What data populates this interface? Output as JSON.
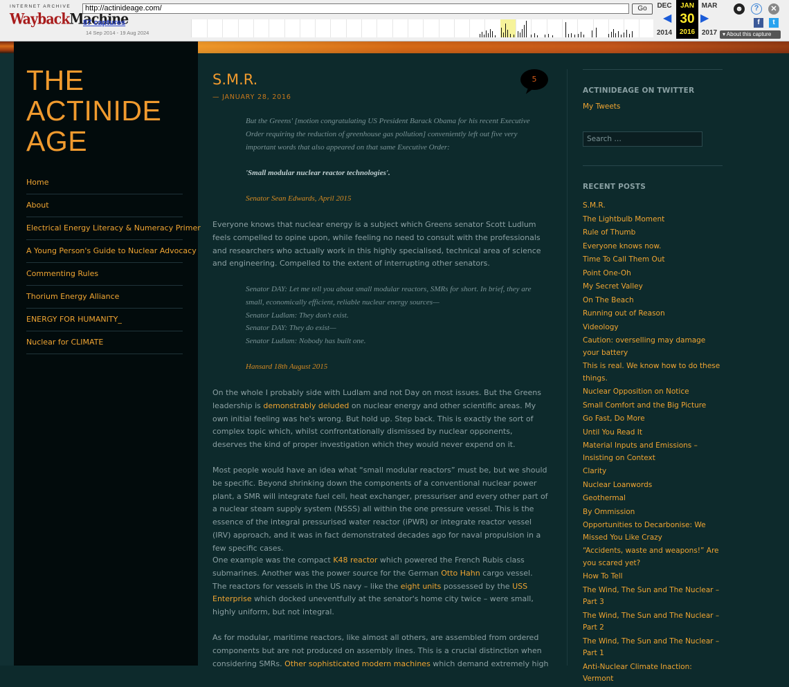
{
  "wayback": {
    "logo_top": "INTERNET ARCHIVE",
    "logo_way": "Wayback",
    "logo_machine": "Machine",
    "url": "http://actinideage.com/",
    "go_label": "Go",
    "captures": "87 captures",
    "range": "14 Sep 2014 - 19 Aug 2024",
    "prev_month": "DEC",
    "prev_year": "2014",
    "cur_month": "JAN",
    "cur_day": "30",
    "cur_year": "2016",
    "next_month": "MAR",
    "next_year": "2017",
    "about": "About this capture",
    "icons": [
      "user-icon",
      "help-icon",
      "close-icon",
      "facebook-icon",
      "twitter-icon"
    ]
  },
  "site": {
    "title_line1": "THE",
    "title_line2": "ACTINIDE",
    "title_line3": "AGE",
    "nav": [
      "Home",
      "About",
      "Electrical Energy Literacy & Numeracy Primer",
      "A Young Person's Guide to Nuclear Advocacy",
      "Commenting Rules",
      "Thorium Energy Alliance",
      "ENERGY FOR HUMANITY_",
      "Nuclear for CLIMATE"
    ]
  },
  "post": {
    "title": "S.M.R.",
    "date": "— JANUARY 28, 2016",
    "comments": "5",
    "quote1": "But the Greens' [motion congratulating US President Barack Obama for his recent Executive Order requiring the reduction of greenhouse gas pollution] conveniently left out five very important words that also appeared on that same Executive Order:",
    "quote1_bold": "'Small modular nuclear reactor technologies'.",
    "cite1": "Senator Sean Edwards, April 2015",
    "para1": "Everyone knows that nuclear energy is a subject which Greens senator Scott Ludlum feels compelled to opine upon, while feeling no need to consult with the professionals and researchers who actually work in this highly specialised, technical area of science and engineering. Compelled to the extent of interrupting other senators.",
    "quote2_l1": "Senator DAY: Let me tell you about small modular reactors, SMRs for short. In brief, they are small, economically efficient, reliable nuclear energy sources—",
    "quote2_l2": "Senator Ludlam: They don't exist.",
    "quote2_l3": "Senator DAY: They do exist—",
    "quote2_l4": "Senator Ludlam: Nobody has built one.",
    "cite2": "Hansard 18th August 2015",
    "para2_a": "On the whole I probably side with Ludlam and not Day on most issues. But the Greens leadership is ",
    "para2_link": "demonstrably deluded",
    "para2_b": " on nuclear energy and other scientific areas. My own initial feeling was he's wrong. But hold up. Step back. This is exactly the sort of complex topic which, whilst confrontationally dismissed by nuclear opponents, deserves the kind of proper investigation which they would never expend on it.",
    "para3": "Most people would have an idea what “small modular reactors” must be, but we should be specific. Beyond shrinking down the components of a conventional nuclear power plant, a SMR will integrate fuel cell, heat exchanger, pressuriser and every other part of a nuclear steam supply system (NSSS) all within the one pressure vessel. This is the essence of the integral pressurised water reactor (iPWR) or integrate reactor vessel (IRV) approach, and it was in fact demonstrated decades ago for naval propulsion in a few specific cases.",
    "para4_a": "One example was the compact ",
    "para4_link1": "K48 reactor",
    "para4_b": " which powered the French Rubis class submarines. Another was the power source for the German ",
    "para4_link2": "Otto Hahn",
    "para4_c": " cargo vessel. The reactors for vessels in the US navy – like the ",
    "para4_link3": "eight units",
    "para4_d": " possessed by the ",
    "para4_link4": "USS Enterprise",
    "para4_e": " which docked uneventfully at the senator's home city twice – were small, highly uniform, but not integral.",
    "para5_a": "As for modular, maritime reactors, like almost all others, are assembled from ordered components but are not produced on assembly lines. This is a crucial distinction when considering SMRs. ",
    "para5_link": "Other sophisticated modern machines",
    "para5_b": " which demand extremely high"
  },
  "sidebar": {
    "twitter_heading": "ACTINIDEAGE ON TWITTER",
    "my_tweets": "My Tweets",
    "search_placeholder": "Search …",
    "recent_heading": "RECENT POSTS",
    "recent": [
      "S.M.R.",
      "The Lightbulb Moment",
      "Rule of Thumb",
      "Everyone knows now.",
      "Time To Call Them Out",
      "Point One-Oh",
      "My Secret Valley",
      "On The Beach",
      "Running out of Reason",
      "Videology",
      "Caution: overselling may damage your battery",
      "This is real. We know how to do these things.",
      "Nuclear Opposition on Notice",
      "Small Comfort and the Big Picture",
      "Go Fast, Do More",
      "Until You Read It",
      "Material Inputs and Emissions – Insisting on Context",
      "Clarity",
      "Nuclear Loanwords",
      "Geothermal",
      "By Ommission",
      "Opportunities to Decarbonise: We Missed You Like Crazy",
      "“Accidents, waste and weapons!” Are you scared yet?",
      "How To Tell",
      "The Wind, The Sun and The Nuclear – Part 3",
      "The Wind, The Sun and The Nuclear – Part 2",
      "The Wind, The Sun and The Nuclear – Part 1",
      "Anti-Nuclear Climate Inaction: Vermont"
    ]
  },
  "colors": {
    "accent": "#f0a532",
    "title": "#f09a2e",
    "background": "#0d2a2c",
    "left_sidebar": "#020b0c",
    "body_text": "#8ca0a3"
  }
}
